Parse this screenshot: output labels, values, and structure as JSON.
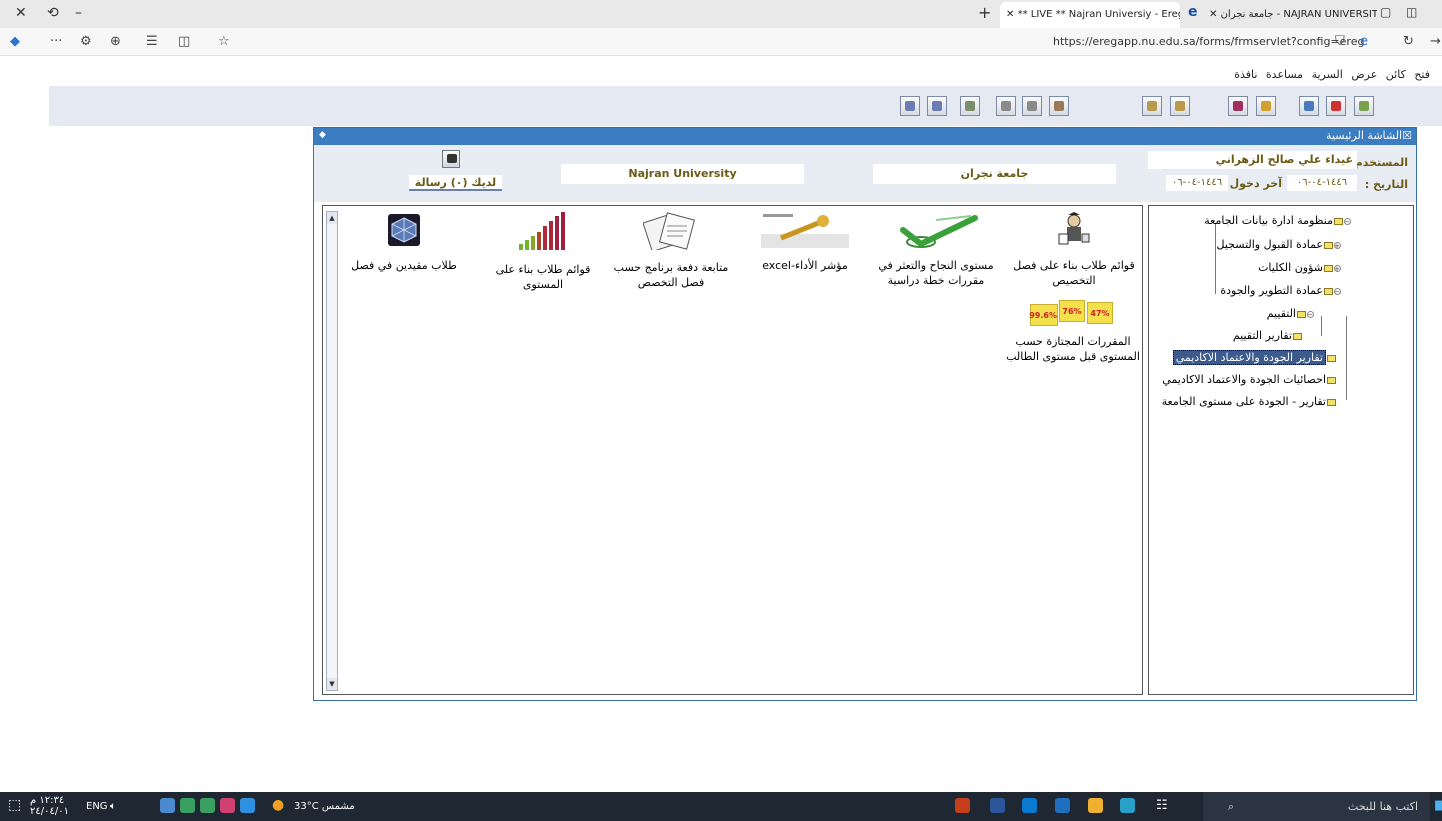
{
  "browser": {
    "tabs": [
      "** LIVE ** Najran Universiy - Eregi",
      "جامعة نجران - NAJRAN UNIVERSITY"
    ],
    "url": "https://eregapp.nu.edu.sa/forms/frmservlet?config=ereg"
  },
  "forms_menu": [
    "فتح",
    "كائن",
    "عرض",
    "السرية",
    "مساعدة",
    "نافذة"
  ],
  "window": {
    "title": "الشاشة الرئيسية"
  },
  "header": {
    "user_label": "المستخدم:",
    "user_name": "غيداء علي صالح الزهراني",
    "date_label": "التاريخ :",
    "date_value": "١٤٤٦-٠٤-٠٦",
    "last_login_label": "آخر دخول",
    "last_login_value": "١٤٤٦-٠٤-٠٦",
    "university_ar": "جامعة نجران",
    "university_en": "Najran University",
    "messages": "لديك (٠) رسالة"
  },
  "tree": {
    "root": "منظومة ادارة بيانات الجامعة",
    "nodes": [
      "عمادة القبول والتسجيل",
      "شؤون الكليات",
      "عمادة التطوير والجودة",
      "التقييم",
      "تقارير التقييم",
      "تقارير الجودة والاعتماد الاكاديمي",
      "احصائيات الجودة والاعتماد الاكاديمي",
      "تقارير - الجودة على مستوى الجامعة"
    ],
    "annotation": "١"
  },
  "content_items": [
    {
      "label": "قوائم طلاب بناء على فصل التخصيص",
      "icon": "teacher-icon"
    },
    {
      "label": "مستوى النجاح والتعثر في مقررات خطة دراسية",
      "icon": "checkmark-icon"
    },
    {
      "label": "مؤشر الأداء-excel",
      "icon": "kpi-icon"
    },
    {
      "label": "متابعة دفعة برنامج حسب فصل التخصص",
      "icon": "documents-icon"
    },
    {
      "label": "قوائم طلاب بناء على المستوى",
      "icon": "bar-chart-icon"
    },
    {
      "label": "طلاب مقيدين في فصل",
      "icon": "cube-icon"
    },
    {
      "label": "المقررات المجتازة حسب المستوى قبل مستوى الطالب",
      "icon": "percent-notes-icon"
    }
  ],
  "percent_notes": [
    "99.6%",
    "76%",
    "47%"
  ],
  "taskbar": {
    "search_placeholder": "اكتب هنا للبحث",
    "weather": "33°C  مشمس",
    "lang": "ENG",
    "time": "١٢:٣٤ م",
    "date": "٢٤/٠٤/٠١"
  }
}
